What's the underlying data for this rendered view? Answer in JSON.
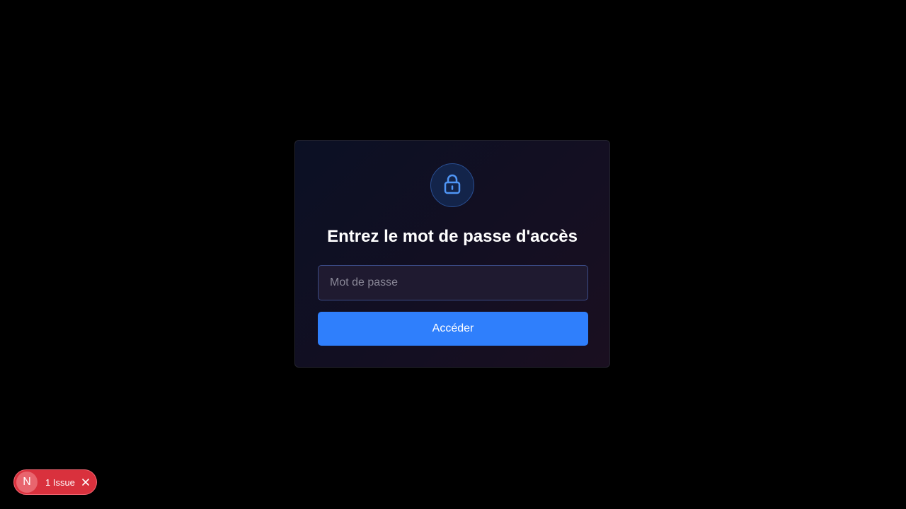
{
  "login": {
    "title": "Entrez le mot de passe d'accès",
    "password_placeholder": "Mot de passe",
    "password_value": "",
    "submit_label": "Accéder",
    "lock_icon": "lock-icon"
  },
  "dev_indicator": {
    "logo_letter": "N",
    "issue_label": "1 Issue",
    "close_icon": "close-icon"
  },
  "colors": {
    "background": "#000000",
    "accent": "#2f7ffc",
    "lock_icon": "#4f95f5",
    "issue_badge": "#d9313d"
  }
}
